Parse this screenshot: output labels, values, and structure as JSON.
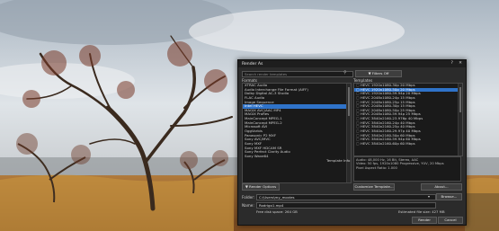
{
  "dialog": {
    "title": "Render As",
    "help_glyph": "?",
    "close_glyph": "✕",
    "search_placeholder": "Search render templates",
    "filters_button": "▼ Filters Off",
    "formats_label": "Formats",
    "templates_label": "Templates",
    "formats": [
      "XTRAC Audio",
      "Audio Interchange File Format (AIFF)",
      "Dolby Digital AC-3 Studio",
      "FLAC Audio",
      "Image Sequence",
      "Intel HEVC",
      "MAGIX AVC/AAC MP4",
      "MAGIX ProRes",
      "MainConcept MPEG-1",
      "MainConcept MPEG-2",
      "Microsoft AVI",
      "OggVorbis",
      "Panasonic P2 MXF",
      "Sony AVC/MVC",
      "Sony MXF",
      "Sony MXF HDCAM SR",
      "Sony Perfect Clarity Audio",
      "Sony Wave64"
    ],
    "selected_format_index": 5,
    "templates": [
      "HEVC 1920x1080-30p 20 Mbps",
      "HEVC 1920x1080-50p 20 Mbps",
      "HEVC 1920x1080-59.94p 20 Mbps",
      "HEVC 2048x1080-24p 15 Mbps",
      "HEVC 2048x1080-25p 15 Mbps",
      "HEVC 2048x1080-30p 15 Mbps",
      "HEVC 2048x1080-50p 25 Mbps",
      "HEVC 2048x1080-59.94p 25 Mbps",
      "HEVC 3840x2160-23.976p 40 Mbps",
      "HEVC 3840x2160-24p 40 Mbps",
      "HEVC 3840x2160-25p 40 Mbps",
      "HEVC 3840x2160-29.97p 40 Mbps",
      "HEVC 3840x2160-50p 60 Mbps",
      "HEVC 3840x2160-59.94p 60 Mbps",
      "HEVC 3840x2160-60p 60 Mbps"
    ],
    "selected_template_index": 1,
    "template_info_label": "Template Info",
    "template_info_lines": [
      "Audio: 48,000 Hz, 16 Bit, Stereo, AAC",
      "Video: 50 fps, 1920x1080 Progressive, YUV, 20 Mbps",
      "Pixel Aspect Ratio: 1.000"
    ],
    "render_options_button": "▼ Render Options",
    "customize_template_button": "Customize Template...",
    "about_button": "About...",
    "folder_label": "Folder:",
    "folder_value": "C:\\Users\\my_movies",
    "browse_button": "Browse...",
    "name_label": "Name:",
    "name_value": "Rodrigo1.mp4",
    "free_disk_space": "Free disk space: 264 GB",
    "estimated_file_size": "Estimated file size: 427 MB",
    "render_button": "Render",
    "cancel_button": "Cancel"
  }
}
